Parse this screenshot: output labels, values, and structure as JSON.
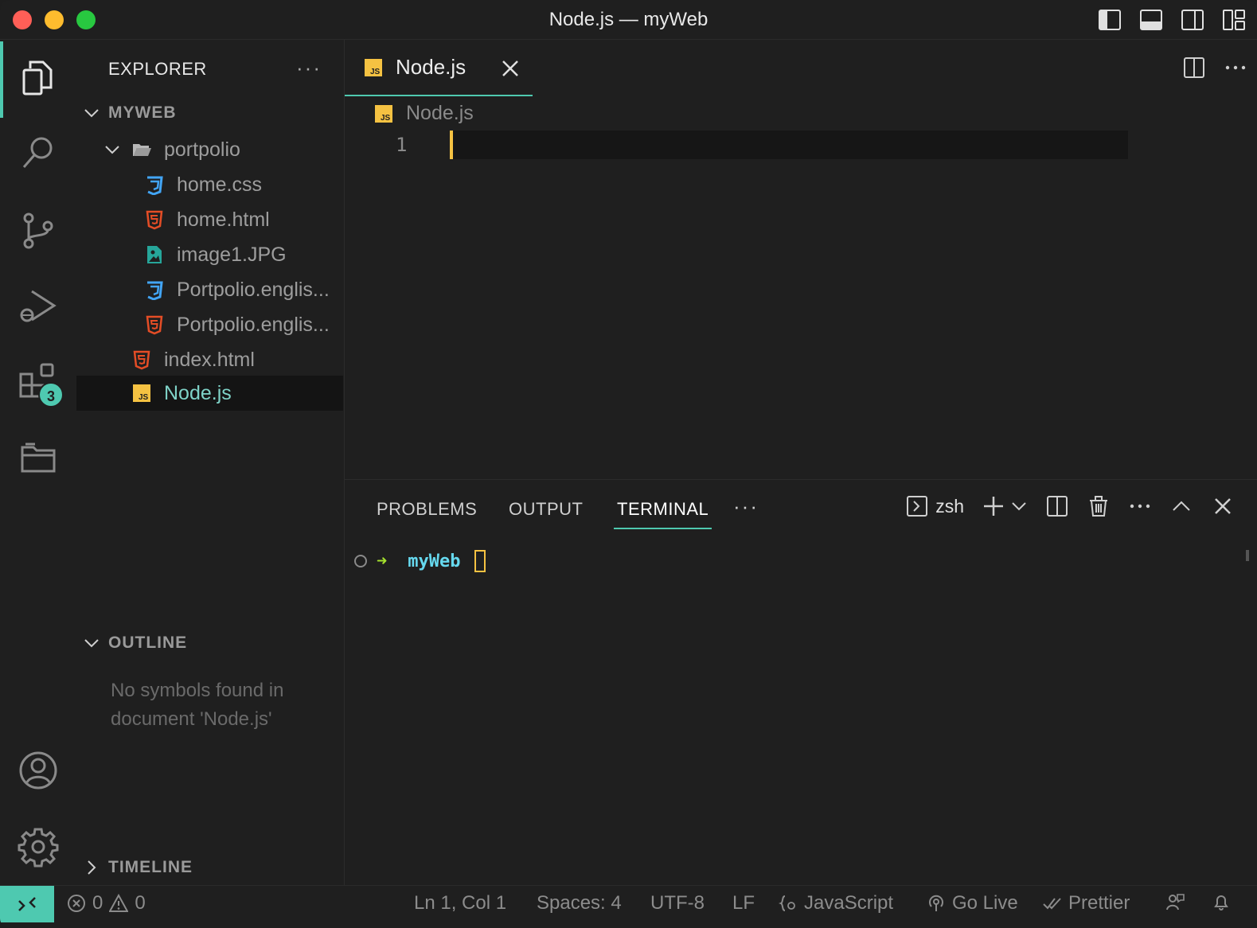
{
  "window": {
    "title": "Node.js — myWeb"
  },
  "activity": {
    "extensions_badge": "3"
  },
  "sidebar": {
    "title": "EXPLORER",
    "more": "···",
    "workspace": "MYWEB",
    "tree": [
      {
        "label": "portpolio",
        "icon": "folder-open-icon"
      },
      {
        "label": "home.css",
        "icon": "css-file-icon"
      },
      {
        "label": "home.html",
        "icon": "html-file-icon"
      },
      {
        "label": "image1.JPG",
        "icon": "image-file-icon"
      },
      {
        "label": "Portpolio.englis...",
        "icon": "css-file-icon"
      },
      {
        "label": "Portpolio.englis...",
        "icon": "html-file-icon"
      },
      {
        "label": "index.html",
        "icon": "html-file-icon"
      },
      {
        "label": "Node.js",
        "icon": "js-file-icon"
      }
    ],
    "outline_title": "OUTLINE",
    "outline_message": "No symbols found in document 'Node.js'",
    "timeline_title": "TIMELINE"
  },
  "editor": {
    "tab_label": "Node.js",
    "breadcrumb": "Node.js",
    "line_number": "1"
  },
  "panel": {
    "tabs": [
      "PROBLEMS",
      "OUTPUT",
      "TERMINAL"
    ],
    "more": "···",
    "shell": "zsh",
    "terminal": {
      "arrow": "➜",
      "dir": "myWeb"
    }
  },
  "status": {
    "errors": "0",
    "warnings": "0",
    "position": "Ln 1, Col 1",
    "spaces": "Spaces: 4",
    "encoding": "UTF-8",
    "eol": "LF",
    "language": "JavaScript",
    "go_live": "Go Live",
    "prettier": "Prettier"
  },
  "colors": {
    "accent": "#4ec9b0",
    "js_icon": "#f5c242",
    "html_icon": "#e44d26",
    "css_icon": "#42a5f5",
    "image_icon": "#26a69a"
  }
}
